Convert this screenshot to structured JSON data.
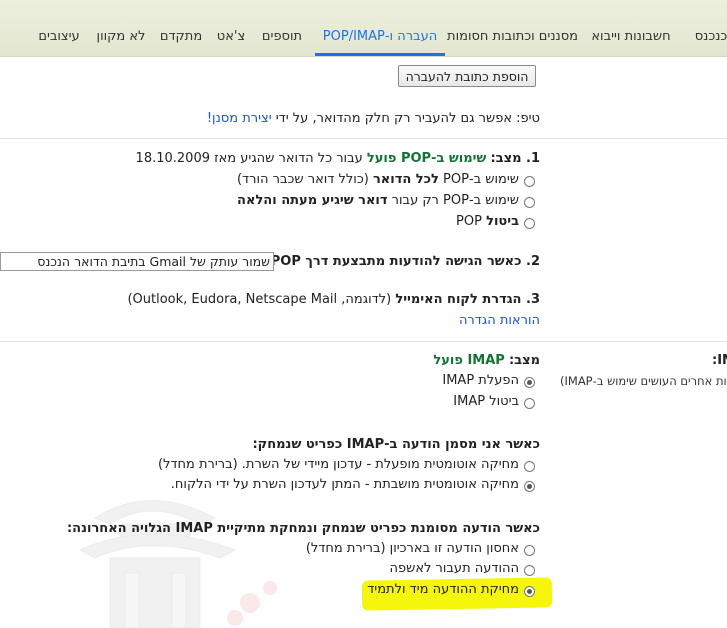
{
  "tabs": [
    {
      "label": "כנכנס"
    },
    {
      "label": "חשבונות וייבוא"
    },
    {
      "label": "מסננים וכתובות חסומות"
    },
    {
      "label": "העברה ו-POP/IMAP"
    },
    {
      "label": "תוספים"
    },
    {
      "label": "צ'אט"
    },
    {
      "label": "מתקדם"
    },
    {
      "label": "לא מקוון"
    },
    {
      "label": "עיצובים"
    }
  ],
  "forwarding": {
    "add_button": "הוספת כתובת להעברה",
    "tip_text": "טיפ: אפשר גם להעביר רק חלק מהדואר, על ידי",
    "tip_link": "יצירת מסנן!"
  },
  "pop": {
    "s1_prefix": "1. מצב:",
    "s1_status": "שימוש ב-POP פועל",
    "s1_suffix": "עבור כל הדואר שהגיע מאז 18.10.2009",
    "opt1_a": "שימוש ב-POP",
    "opt1_b": "לכל הדואר",
    "opt1_c": "(כולל דואר שכבר הורד)",
    "opt2_a": "שימוש ב-POP רק עבור",
    "opt2_b": "דואר שיגיע מעתה והלאה",
    "opt3_a": "ביטול",
    "opt3_b": "POP",
    "s2_label": "2. כאשר הגישה להודעות מתבצעת דרך",
    "s2_pop": "POP",
    "s2_value": "שמור עותק של Gmail בתיבת הדואר הנכנס",
    "s3_label": "3. הגדרת לקוח האימייל",
    "s3_example": "(לדוגמה, Outlook, Eudora, Netscape Mail)",
    "s3_link": "הוראות הגדרה"
  },
  "imap": {
    "side_title": ":IM",
    "side_desc": "קוחות אחרים העושים שימוש ב-IMAP)",
    "status_label": "מצב:",
    "status_value": "IMAP פועל",
    "enable": "הפעלת IMAP",
    "disable": "ביטול IMAP",
    "deleted_heading": "כאשר אני מסמן הודעה ב-IMAP כפריט שנמחק:",
    "auto_on": "מחיקה אוטומטית מופעלת - עדכון מיידי של השרת. (ברירת מחדל)",
    "auto_off": "מחיקה אוטומטית מושבתת - המתן לעדכון השרת על ידי הלקוח.",
    "expunge_heading": "כאשר הודעה מסומנת כפריט שנמחק ונמחקת מתיקיית IMAP הגלויה האחרונה:",
    "archive": "אחסון הודעה זו בארכיון (ברירת מחדל)",
    "trash": "ההודעה תעבור לאשפה",
    "delete_forever": "מחיקת ההודעה מיד ולתמיד"
  },
  "colors": {
    "accent": "#1a73e8",
    "status_green": "#137333",
    "highlight": "#f5f500"
  }
}
